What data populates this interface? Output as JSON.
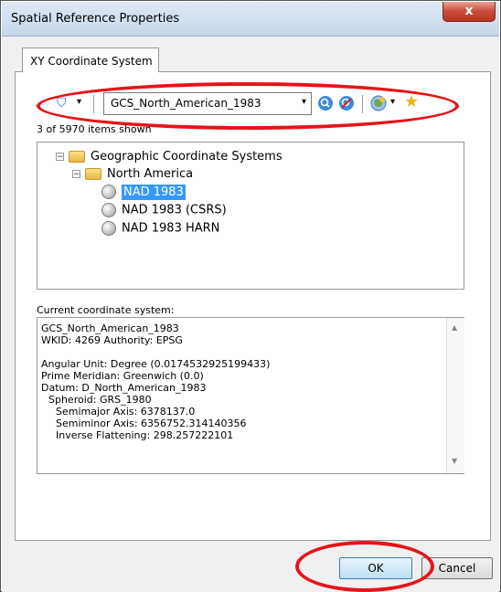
{
  "window": {
    "title": "Spatial Reference Properties",
    "close_glyph": "x"
  },
  "tabs": [
    {
      "label": "XY Coordinate System"
    }
  ],
  "toolbar": {
    "filter_icon": "filter-icon",
    "dropdown_glyph": "▾",
    "search_value": "GCS_North_American_1983",
    "search_icon": "search-icon",
    "clear_search_icon": "clear-search-icon",
    "globe_menu_icon": "globe-icon",
    "favorites_icon": "add-favorite-star-icon"
  },
  "result_count": "3 of 5970 items shown",
  "tree": {
    "root": {
      "label": "Geographic Coordinate Systems",
      "expander": "−"
    },
    "child": {
      "label": "North America",
      "expander": "−"
    },
    "items": [
      {
        "label": "NAD 1983",
        "selected": true
      },
      {
        "label": "NAD 1983 (CSRS)",
        "selected": false
      },
      {
        "label": "NAD 1983 HARN",
        "selected": false
      }
    ]
  },
  "current_cs": {
    "label": "Current coordinate system:",
    "lines": [
      "GCS_North_American_1983",
      "WKID: 4269 Authority: EPSG",
      "",
      "Angular Unit: Degree (0.0174532925199433)",
      "Prime Meridian: Greenwich (0.0)",
      "Datum: D_North_American_1983",
      "  Spheroid: GRS_1980",
      "    Semimajor Axis: 6378137.0",
      "    Semiminor Axis: 6356752.314140356",
      "    Inverse Flattening: 298.257222101"
    ]
  },
  "buttons": {
    "ok": "OK",
    "cancel": "Cancel"
  },
  "colors": {
    "highlight_ellipse": "#e3151a",
    "selection": "#3399ff"
  }
}
